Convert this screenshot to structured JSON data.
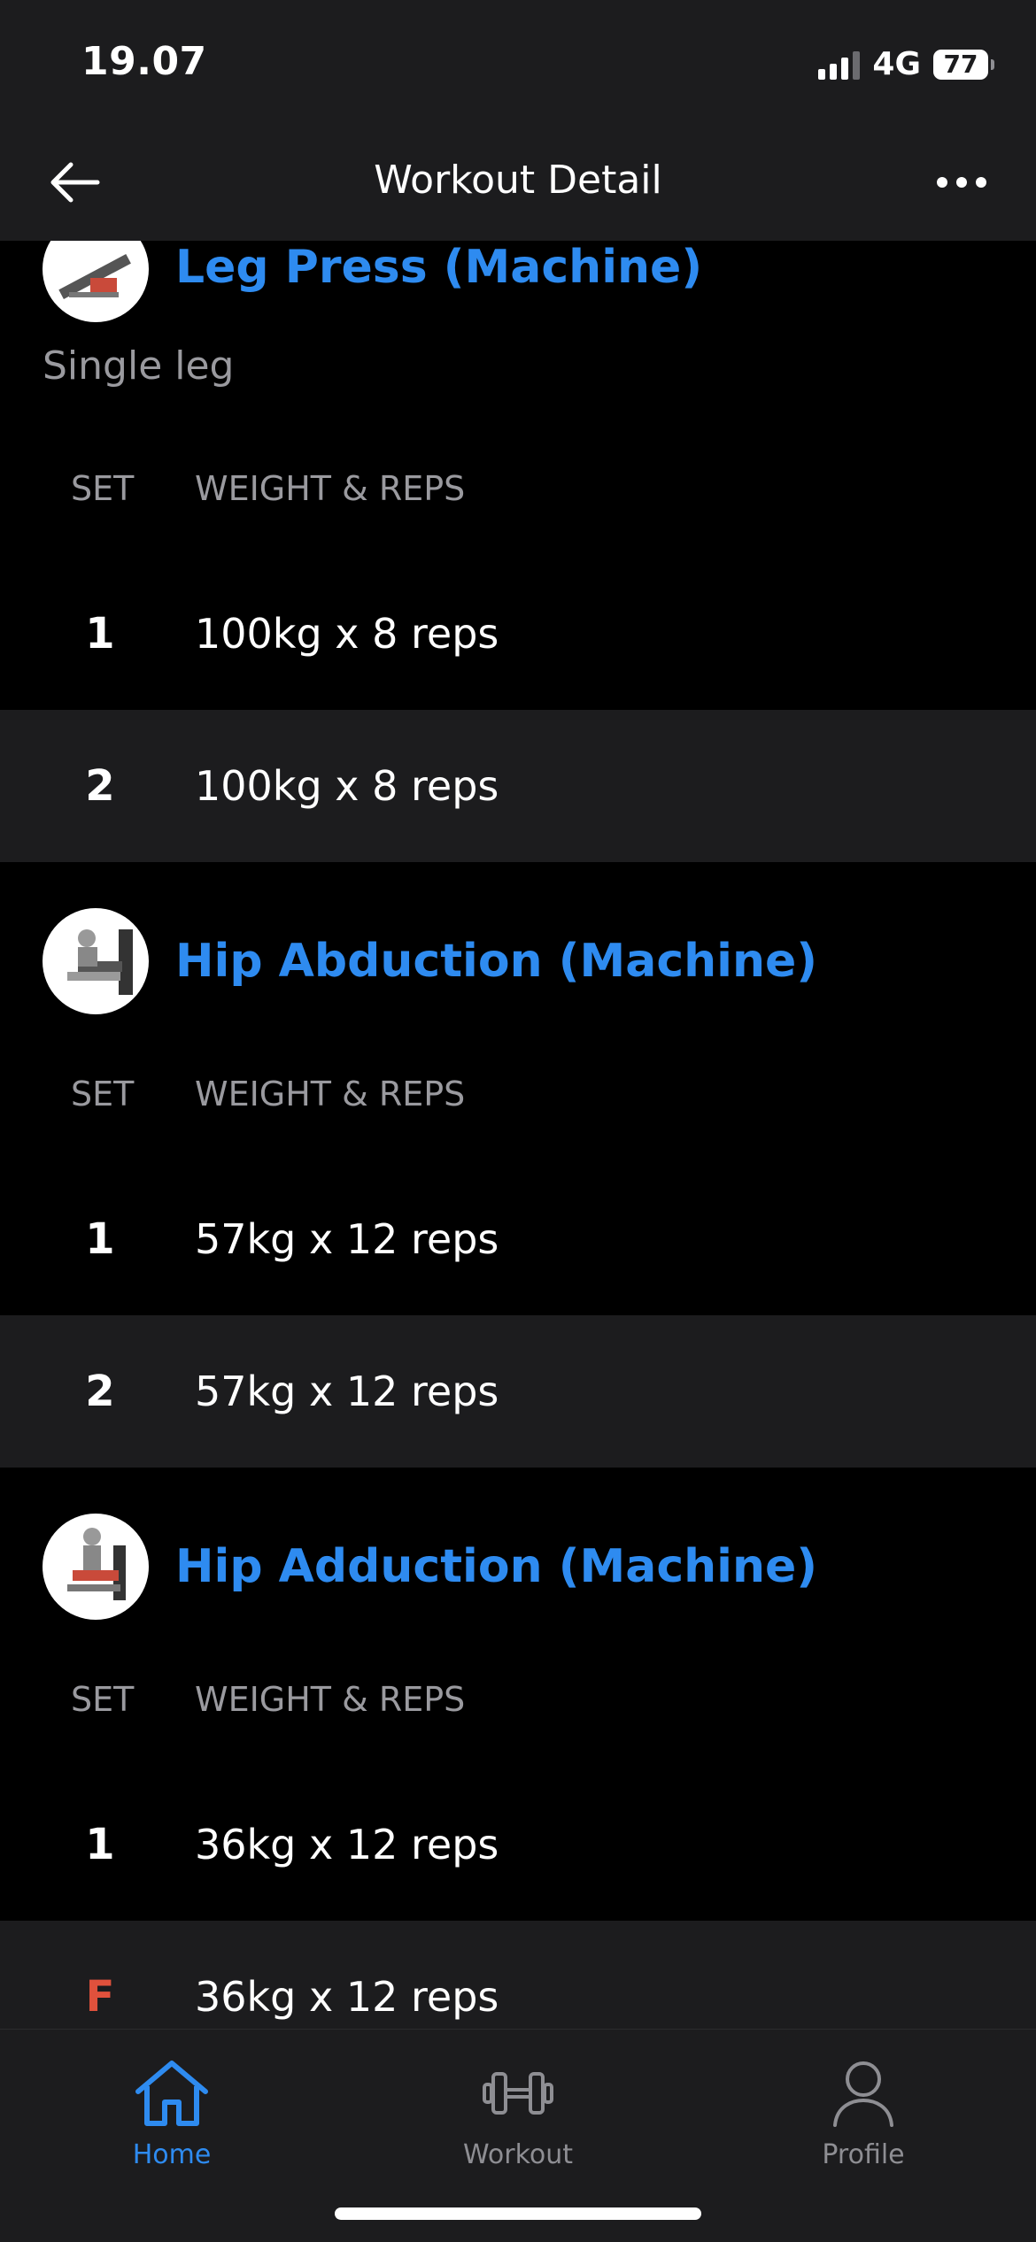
{
  "status_bar": {
    "time": "19.07",
    "network": "4G",
    "battery": "77"
  },
  "header": {
    "title": "Workout Detail"
  },
  "columns": {
    "set": "SET",
    "weight_reps": "WEIGHT & REPS"
  },
  "exercises": [
    {
      "name": "Leg Press (Machine)",
      "note": "Single leg",
      "sets": [
        {
          "label": "1",
          "value": "100kg x 8 reps"
        },
        {
          "label": "2",
          "value": "100kg x 8 reps"
        }
      ]
    },
    {
      "name": "Hip Abduction (Machine)",
      "sets": [
        {
          "label": "1",
          "value": "57kg x 12 reps"
        },
        {
          "label": "2",
          "value": "57kg x 12 reps"
        }
      ]
    },
    {
      "name": "Hip Adduction (Machine)",
      "sets": [
        {
          "label": "1",
          "value": "36kg x 12 reps"
        },
        {
          "label": "F",
          "value": "36kg x 12 reps"
        }
      ]
    }
  ],
  "tabs": [
    {
      "label": "Home",
      "icon": "home-icon",
      "active": true
    },
    {
      "label": "Workout",
      "icon": "dumbbell-icon",
      "active": false
    },
    {
      "label": "Profile",
      "icon": "person-icon",
      "active": false
    }
  ],
  "colors": {
    "accent": "#2e8bf0",
    "failure_set": "#e0513c",
    "background": "#000000",
    "surface": "#1c1c1e"
  }
}
